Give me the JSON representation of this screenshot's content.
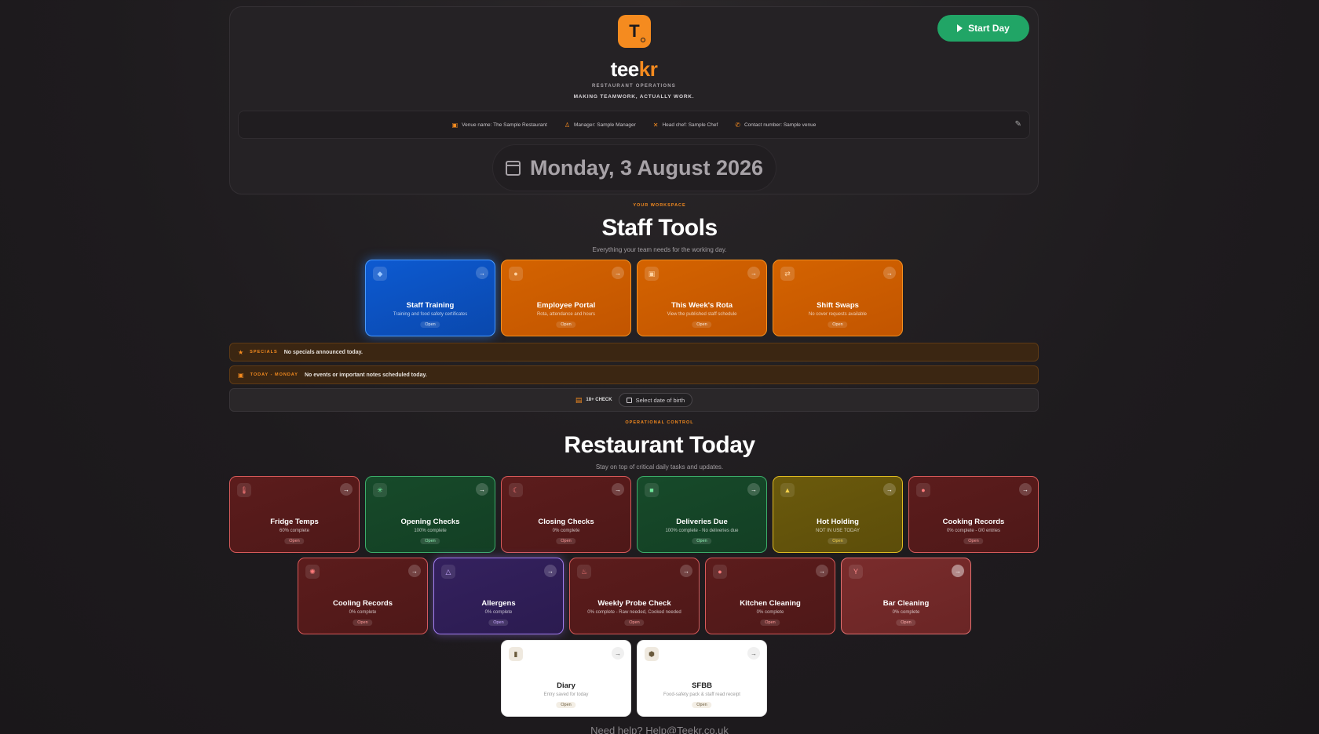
{
  "header": {
    "logo_letter": "T",
    "brand_w": "tee",
    "brand_o": "kr",
    "tagline1": "RESTAURANT OPERATIONS",
    "tagline2": "MAKING TEAMWORK, ACTUALLY WORK.",
    "start_label": "Start Day",
    "info": {
      "venue": "Venue name: The Sample Restaurant",
      "manager": "Manager: Sample Manager",
      "chef": "Head chef: Sample Chef",
      "contact": "Contact number: Sample venue"
    },
    "date": "Monday, 3 August 2026"
  },
  "staff": {
    "eyebrow": "YOUR WORKSPACE",
    "title": "Staff Tools",
    "subtitle": "Everything your team needs for the working day.",
    "tiles": [
      {
        "title": "Staff Training",
        "sub": "Training and food safety certificates",
        "open": "Open"
      },
      {
        "title": "Employee Portal",
        "sub": "Rota, attendance and hours",
        "open": "Open"
      },
      {
        "title": "This Week's Rota",
        "sub": "View the published staff schedule",
        "open": "Open"
      },
      {
        "title": "Shift Swaps",
        "sub": "No cover requests available",
        "open": "Open"
      }
    ]
  },
  "specials": {
    "label": "SPECIALS",
    "text": "No specials announced today."
  },
  "today": {
    "label": "TODAY - MONDAY",
    "text": "No events or important notes scheduled today."
  },
  "check": {
    "label": "18+ CHECK",
    "button": "Select date of birth"
  },
  "restaurant": {
    "eyebrow": "OPERATIONAL CONTROL",
    "title": "Restaurant Today",
    "subtitle": "Stay on top of critical daily tasks and updates.",
    "row1": [
      {
        "title": "Fridge Temps",
        "sub": "60% complete",
        "open": "Open"
      },
      {
        "title": "Opening Checks",
        "sub": "100% complete",
        "open": "Open"
      },
      {
        "title": "Closing Checks",
        "sub": "0% complete",
        "open": "Open"
      },
      {
        "title": "Deliveries Due",
        "sub": "100% complete - No deliveries due",
        "open": "Open"
      },
      {
        "title": "Hot Holding",
        "sub": "NOT IN USE TODAY",
        "open": "Open"
      },
      {
        "title": "Cooking Records",
        "sub": "0% complete - 0/0 entries",
        "open": "Open"
      }
    ],
    "row2": [
      {
        "title": "Cooling Records",
        "sub": "0% complete",
        "open": "Open"
      },
      {
        "title": "Allergens",
        "sub": "0% complete",
        "open": "Open"
      },
      {
        "title": "Weekly Probe Check",
        "sub": "0% complete - Raw needed, Cooked needed",
        "open": "Open"
      },
      {
        "title": "Kitchen Cleaning",
        "sub": "0% complete",
        "open": "Open"
      },
      {
        "title": "Bar Cleaning",
        "sub": "0% complete",
        "open": "Open"
      }
    ],
    "row3": [
      {
        "title": "Diary",
        "sub": "Entry saved for today",
        "open": "Open"
      },
      {
        "title": "SFBB",
        "sub": "Food-safety pack & staff read receipt",
        "open": "Open"
      }
    ]
  },
  "footer": "Need help? Help@Teekr.co.uk",
  "colors": {
    "accent": "#f58b1f",
    "start": "#21a566"
  }
}
